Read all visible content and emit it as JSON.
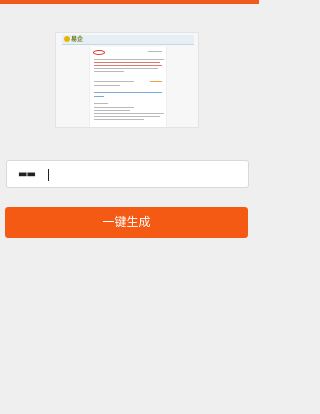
{
  "colors": {
    "accent": "#f05a1a",
    "button": "#f55a14",
    "background": "#efefef"
  },
  "preview": {
    "logo_text": "易企"
  },
  "input": {
    "value": "▬▬"
  },
  "generate_button": {
    "label": "一键生成"
  }
}
